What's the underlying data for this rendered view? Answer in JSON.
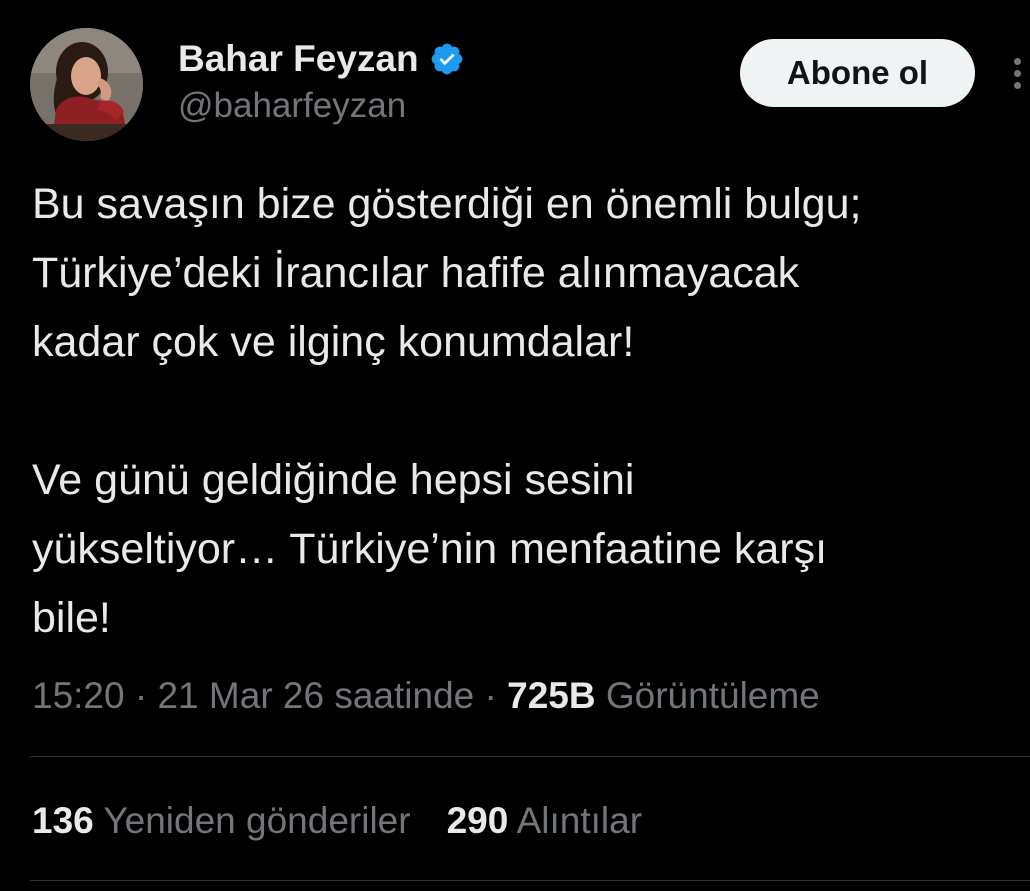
{
  "author": {
    "display_name": "Bahar Feyzan",
    "handle": "@baharfeyzan",
    "verified": true,
    "verified_badge_color": "#1d9bf0"
  },
  "actions": {
    "follow_label": "Abone ol",
    "more_icon": "more-vertical-icon"
  },
  "tweet": {
    "paragraphs": [
      [
        "Bu savaşın bize gösterdiği en önemli bulgu;",
        "Türkiye’deki İrancılar hafife alınmayacak",
        "kadar çok ve ilginç konumdalar!"
      ],
      [
        "Ve günü geldiğinde hepsi sesini",
        "yükseltiyor… Türkiye’nin menfaatine karşı",
        "bile!"
      ]
    ]
  },
  "meta": {
    "time": "15:20",
    "separator": "·",
    "date": "21 Mar 26 saatinde",
    "views_count": "725B",
    "views_label": "Görüntüleme"
  },
  "stats": {
    "reposts_count": "136",
    "reposts_label": "Yeniden gönderiler",
    "quotes_count": "290",
    "quotes_label": "Alıntılar"
  },
  "colors": {
    "background": "#000000",
    "text_primary": "#e7e9ea",
    "text_secondary": "#71767b",
    "divider": "#2f3336",
    "follow_button_bg": "#eff3f4"
  }
}
